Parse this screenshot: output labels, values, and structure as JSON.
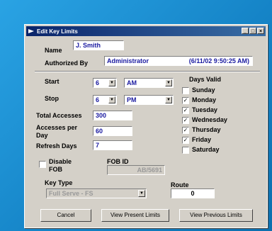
{
  "window": {
    "title": "Edit Key Limits",
    "min_glyph": "_",
    "max_glyph": "□",
    "close_glyph": "×"
  },
  "name": {
    "label": "Name",
    "value": "J. Smith"
  },
  "authorized": {
    "label": "Authorized By",
    "user": "Administrator",
    "timestamp": "(6/11/02 9:50:25 AM)"
  },
  "start": {
    "label": "Start",
    "hour": "6",
    "ampm": "AM"
  },
  "stop": {
    "label": "Stop",
    "hour": "6",
    "ampm": "PM"
  },
  "dropdown_glyph": "▼",
  "total_accesses": {
    "label": "Total Accesses",
    "value": "300"
  },
  "accesses_per_day": {
    "label_line1": "Accesses per",
    "label_line2": "Day",
    "value": "60"
  },
  "refresh_days": {
    "label": "Refresh Days",
    "value": "7"
  },
  "disable_fob": {
    "label_line1": "Disable",
    "label_line2": "FOB",
    "checked": false
  },
  "fob_id": {
    "label": "FOB ID",
    "value": "AB/5691"
  },
  "key_type": {
    "label": "Key Type",
    "value": "Full Serve - FS"
  },
  "route": {
    "label": "Route",
    "value": "0"
  },
  "days_valid": {
    "label": "Days Valid",
    "days": [
      {
        "name": "Sunday",
        "checked": false
      },
      {
        "name": "Monday",
        "checked": true
      },
      {
        "name": "Tuesday",
        "checked": true
      },
      {
        "name": "Wednesday",
        "checked": true
      },
      {
        "name": "Thursday",
        "checked": true
      },
      {
        "name": "Friday",
        "checked": true
      },
      {
        "name": "Saturday",
        "checked": false
      }
    ]
  },
  "check_mark": "✓",
  "buttons": {
    "cancel": "Cancel",
    "present": "View Present Limits",
    "previous": "View Previous Limits"
  }
}
